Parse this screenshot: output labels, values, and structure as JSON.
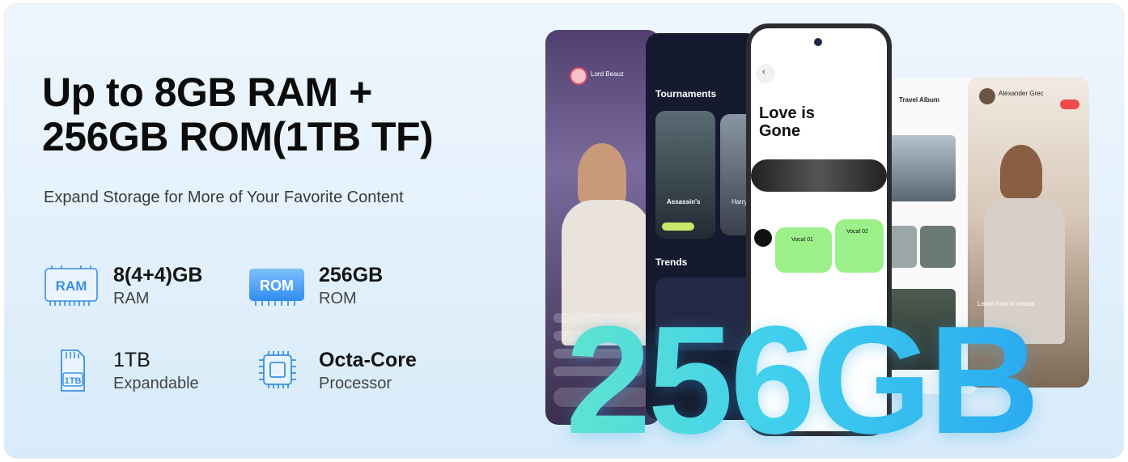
{
  "headline": {
    "line1": "Up to 8GB RAM +",
    "line2": "256GB ROM(1TB TF)"
  },
  "subline": "Expand Storage for More of Your Favorite Content",
  "specs": [
    {
      "icon": "ram-chip-icon",
      "icon_text": "RAM",
      "value": "8(4+4)GB",
      "label": "RAM"
    },
    {
      "icon": "rom-chip-icon",
      "icon_text": "ROM",
      "value": "256GB",
      "label": "ROM"
    },
    {
      "icon": "sd-card-icon",
      "icon_text": "1TB",
      "value": "1TB",
      "label": "Expandable"
    },
    {
      "icon": "processor-chip-icon",
      "value": "Octa-Core",
      "label": "Processor"
    }
  ],
  "big_text": "256GB",
  "screens": {
    "stream_user": "Lord Beauz",
    "tournaments_title": "Tournaments",
    "game1": "Assassin's",
    "game2": "Harry",
    "trends": "Trends",
    "project_title_1": "Love is",
    "project_title_2": "Gone",
    "vocal1": "Vocal 01",
    "vocal2": "Vocal 02",
    "album_title": "Travel Album",
    "profile_name": "Alexander Grec",
    "caption": "Learn how to create"
  },
  "colors": {
    "accent_blue": "#2f8df0",
    "big_text_start": "#5fe4cf",
    "big_text_end": "#2aaaf0"
  }
}
